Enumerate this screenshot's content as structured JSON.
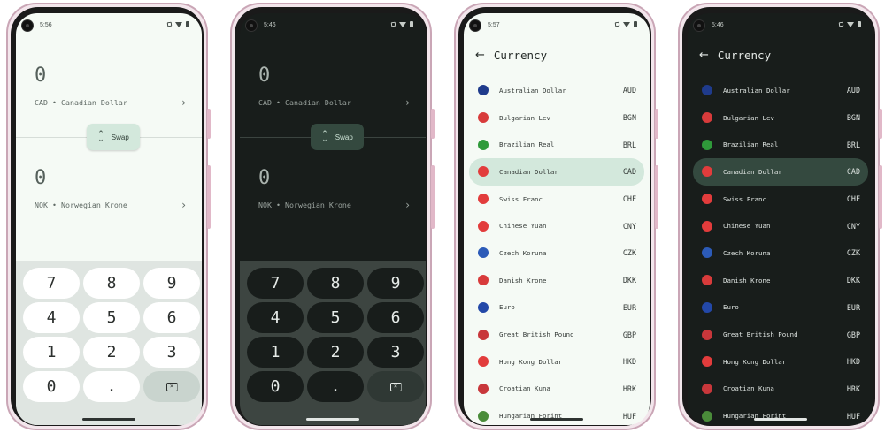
{
  "screens": [
    {
      "theme": "light",
      "time": "5:56",
      "from": {
        "amount": "0",
        "label": "CAD • Canadian Dollar"
      },
      "swap_label": "Swap",
      "to": {
        "amount": "0",
        "label": "NOK • Norwegian Krone"
      },
      "keys": [
        "7",
        "8",
        "9",
        "4",
        "5",
        "6",
        "1",
        "2",
        "3",
        "0",
        "."
      ],
      "backspace_icon": "backspace-icon"
    },
    {
      "theme": "dark",
      "time": "5:46",
      "from": {
        "amount": "0",
        "label": "CAD • Canadian Dollar"
      },
      "swap_label": "Swap",
      "to": {
        "amount": "0",
        "label": "NOK • Norwegian Krone"
      },
      "keys": [
        "7",
        "8",
        "9",
        "4",
        "5",
        "6",
        "1",
        "2",
        "3",
        "0",
        "."
      ],
      "backspace_icon": "backspace-icon"
    },
    {
      "theme": "light",
      "time": "5:57",
      "title": "Currency",
      "selected_code": "CAD",
      "selected_color": "#d3e8dc"
    },
    {
      "theme": "dark",
      "time": "5:46",
      "title": "Currency",
      "selected_code": "CAD",
      "selected_color": "#34493f"
    }
  ],
  "currencies": [
    {
      "name": "Australian Dollar",
      "code": "AUD",
      "flag_color": "#1f3b8c"
    },
    {
      "name": "Bulgarian Lev",
      "code": "BGN",
      "flag_color": "#d83b3b"
    },
    {
      "name": "Brazilian Real",
      "code": "BRL",
      "flag_color": "#2f9a3a"
    },
    {
      "name": "Canadian Dollar",
      "code": "CAD",
      "flag_color": "#e23c3c"
    },
    {
      "name": "Swiss Franc",
      "code": "CHF",
      "flag_color": "#e23c3c"
    },
    {
      "name": "Chinese Yuan",
      "code": "CNY",
      "flag_color": "#e23c3c"
    },
    {
      "name": "Czech Koruna",
      "code": "CZK",
      "flag_color": "#2c5bb8"
    },
    {
      "name": "Danish Krone",
      "code": "DKK",
      "flag_color": "#d83b3b"
    },
    {
      "name": "Euro",
      "code": "EUR",
      "flag_color": "#2348a8"
    },
    {
      "name": "Great British Pound",
      "code": "GBP",
      "flag_color": "#c8373b"
    },
    {
      "name": "Hong Kong Dollar",
      "code": "HKD",
      "flag_color": "#e23c3c"
    },
    {
      "name": "Croatian Kuna",
      "code": "HRK",
      "flag_color": "#c8373b"
    },
    {
      "name": "Hungarian Forint",
      "code": "HUF",
      "flag_color": "#4a8c3a"
    }
  ]
}
